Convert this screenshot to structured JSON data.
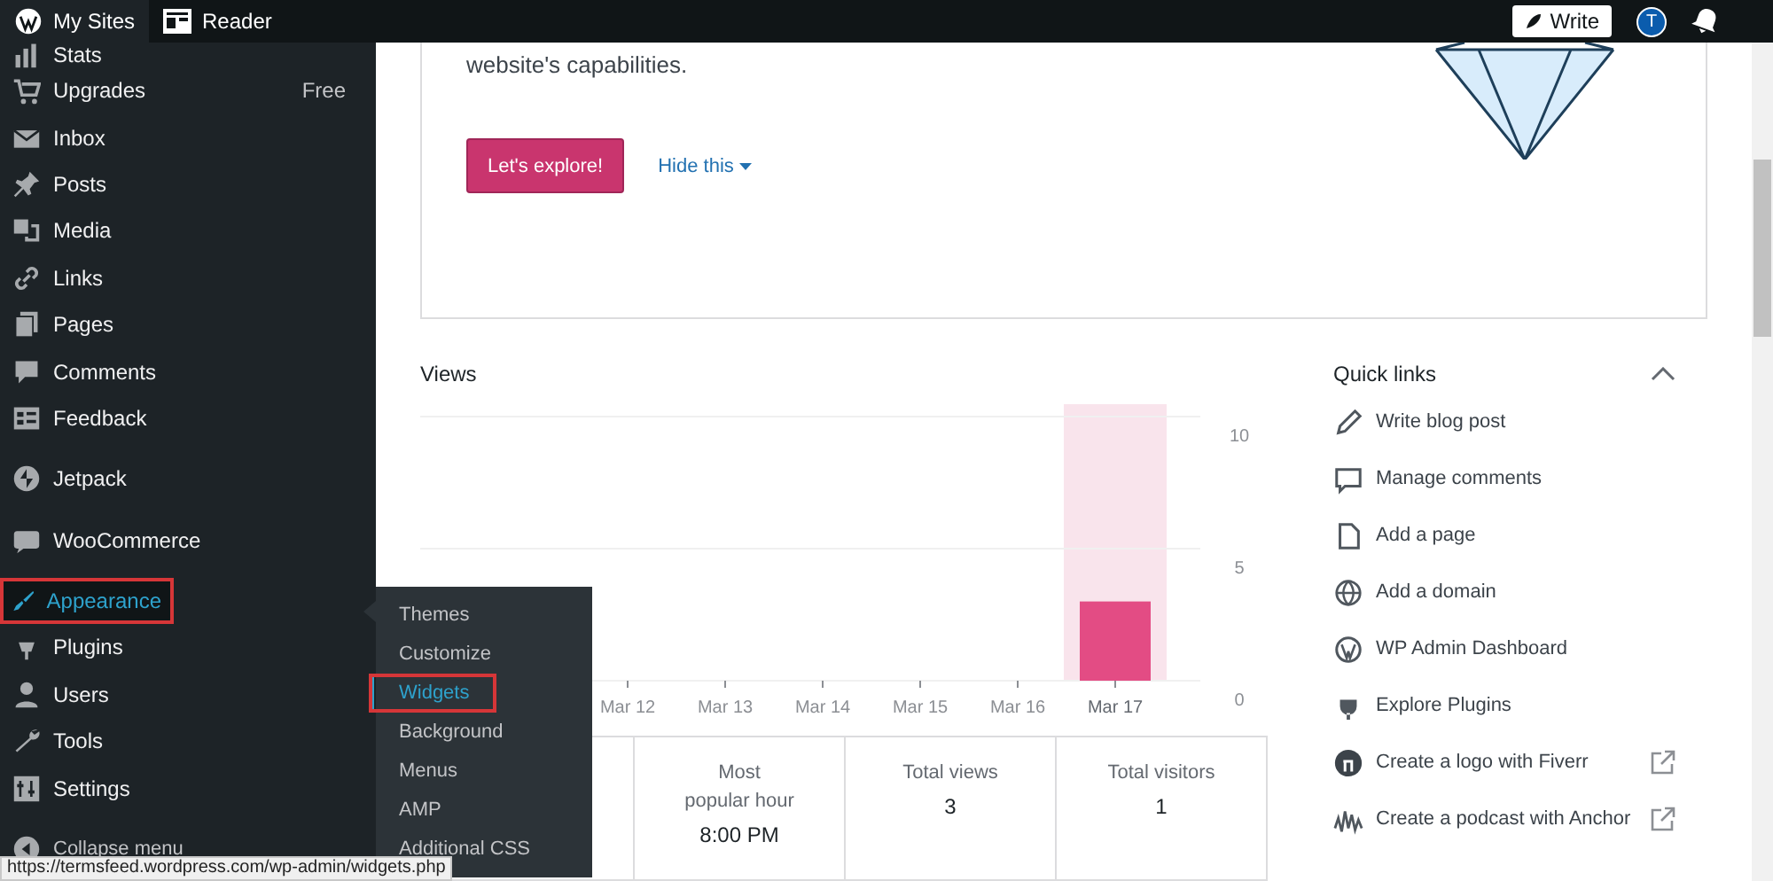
{
  "top_bar": {
    "items": [
      {
        "label": "My Sites",
        "selected": true
      },
      {
        "label": "Reader",
        "selected": false
      }
    ],
    "write_button": "Write",
    "avatar": "T"
  },
  "sidebar": {
    "groups": [
      [
        {
          "label": "Stats",
          "selected": false,
          "annotated": false
        },
        {
          "label": "Upgrades",
          "badge": "Free",
          "selected": false,
          "annotated": false
        },
        {
          "label": "Inbox",
          "selected": false,
          "annotated": false
        },
        {
          "label": "Posts",
          "selected": false,
          "annotated": false
        },
        {
          "label": "Media",
          "selected": false,
          "annotated": false
        },
        {
          "label": "Links",
          "selected": false,
          "annotated": false
        },
        {
          "label": "Pages",
          "selected": false,
          "annotated": false
        },
        {
          "label": "Comments",
          "selected": false,
          "annotated": false
        },
        {
          "label": "Feedback",
          "selected": false,
          "annotated": false
        }
      ],
      [
        {
          "label": "Jetpack",
          "selected": false,
          "annotated": false
        }
      ],
      [
        {
          "label": "WooCommerce",
          "selected": false,
          "annotated": false
        }
      ],
      [
        {
          "label": "Appearance",
          "selected": true,
          "annotated": true
        },
        {
          "label": "Plugins",
          "selected": false,
          "annotated": false
        },
        {
          "label": "Users",
          "selected": false,
          "annotated": false
        },
        {
          "label": "Tools",
          "selected": false,
          "annotated": false
        },
        {
          "label": "Settings",
          "selected": false,
          "annotated": false
        }
      ]
    ],
    "collapse": "Collapse menu"
  },
  "submenu": {
    "items": [
      {
        "label": "Themes",
        "selected": false,
        "annotated": false
      },
      {
        "label": "Customize",
        "selected": false,
        "annotated": false
      },
      {
        "label": "Widgets",
        "selected": true,
        "annotated": true
      },
      {
        "label": "Background",
        "selected": false,
        "annotated": false
      },
      {
        "label": "Menus",
        "selected": false,
        "annotated": false
      },
      {
        "label": "AMP",
        "selected": false,
        "annotated": false
      },
      {
        "label": "Additional CSS",
        "selected": false,
        "annotated": false
      }
    ]
  },
  "promo_card": {
    "text": "website's capabilities.",
    "button": "Let's explore!",
    "link": "Hide this"
  },
  "views": {
    "title": "Views",
    "chart_data": {
      "type": "bar",
      "categories": [
        "Mar 12",
        "Mar 13",
        "Mar 14",
        "Mar 15",
        "Mar 16",
        "Mar 17"
      ],
      "values": [
        0,
        0,
        0,
        0,
        0,
        3
      ],
      "ylim": [
        0,
        10
      ],
      "yticks": [
        0,
        5,
        10
      ]
    },
    "columns": [
      {
        "selected": false
      },
      {
        "selected": false
      },
      {
        "selected": false
      },
      {
        "selected": false
      },
      {
        "selected": false
      },
      {
        "selected": true
      }
    ],
    "stats": [
      {
        "label": "Most popular hour",
        "value": "8:00 PM"
      },
      {
        "label": "Total views",
        "value": "3"
      },
      {
        "label": "Total visitors",
        "value": "1"
      }
    ]
  },
  "quick_links": {
    "title": "Quick links",
    "expanded": true,
    "items": [
      {
        "label": "Write blog post",
        "external": false
      },
      {
        "label": "Manage comments",
        "external": false
      },
      {
        "label": "Add a page",
        "external": false
      },
      {
        "label": "Add a domain",
        "external": false
      },
      {
        "label": "WP Admin Dashboard",
        "external": false
      },
      {
        "label": "Explore Plugins",
        "external": false
      },
      {
        "label": "Create a logo with Fiverr",
        "external": true
      },
      {
        "label": "Create a podcast with Anchor",
        "external": true
      }
    ]
  },
  "status_bar": {
    "url": "https://termsfeed.wordpress.com/wp-admin/widgets.php"
  }
}
